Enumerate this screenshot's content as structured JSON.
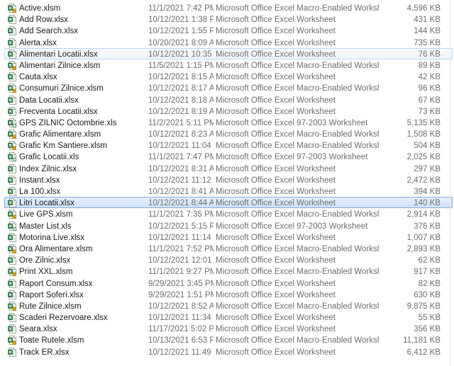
{
  "files": [
    {
      "name": "Active.xlsm",
      "date": "11/1/2021 7:42 PM",
      "type": "Microsoft Office Excel Macro-Enabled Worksheet",
      "size": "4,596 KB",
      "icon": "excel-macro-file-icon"
    },
    {
      "name": "Add Row.xlsx",
      "date": "10/12/2021 1:38 PM",
      "type": "Microsoft Office Excel Worksheet",
      "size": "431 KB",
      "icon": "excel-file-icon"
    },
    {
      "name": "Add Search.xlsx",
      "date": "10/12/2021 1:55 PM",
      "type": "Microsoft Office Excel Worksheet",
      "size": "144 KB",
      "icon": "excel-file-icon"
    },
    {
      "name": "Alerta.xlsx",
      "date": "10/20/2021 8:09 AM",
      "type": "Microsoft Office Excel Worksheet",
      "size": "735 KB",
      "icon": "excel-file-icon"
    },
    {
      "name": "Alimentari Locatii.xlsx",
      "date": "10/12/2021 10:35 ...",
      "type": "Microsoft Office Excel Worksheet",
      "size": "76 KB",
      "icon": "excel-file-icon",
      "state": "hover"
    },
    {
      "name": "Alimentari Zilnice.xlsm",
      "date": "11/5/2021 1:15 PM",
      "type": "Microsoft Office Excel Macro-Enabled Worksheet",
      "size": "89 KB",
      "icon": "excel-macro-file-icon"
    },
    {
      "name": "Cauta.xlsx",
      "date": "10/12/2021 8:15 AM",
      "type": "Microsoft Office Excel Worksheet",
      "size": "42 KB",
      "icon": "excel-file-icon"
    },
    {
      "name": "Consumuri Zilnice.xlsm",
      "date": "10/12/2021 8:17 AM",
      "type": "Microsoft Office Excel Macro-Enabled Worksheet",
      "size": "96 KB",
      "icon": "excel-macro-file-icon"
    },
    {
      "name": "Data Locatii.xlsx",
      "date": "10/12/2021 8:18 AM",
      "type": "Microsoft Office Excel Worksheet",
      "size": "67 KB",
      "icon": "excel-file-icon"
    },
    {
      "name": "Frecventa Locatii.xlsx",
      "date": "10/12/2021 8:19 AM",
      "type": "Microsoft Office Excel Worksheet",
      "size": "73 KB",
      "icon": "excel-file-icon"
    },
    {
      "name": "GPS ZILNIC Octombrie.xls",
      "date": "11/2/2021 5:11 PM",
      "type": "Microsoft Office Excel 97-2003 Worksheet",
      "size": "5,135 KB",
      "icon": "excel-97-file-icon"
    },
    {
      "name": "Grafic Alimentare.xlsm",
      "date": "10/12/2021 8:23 AM",
      "type": "Microsoft Office Excel Macro-Enabled Worksheet",
      "size": "1,508 KB",
      "icon": "excel-macro-file-icon"
    },
    {
      "name": "Grafic Km Santiere.xlsm",
      "date": "10/12/2021 11:04 ...",
      "type": "Microsoft Office Excel Macro-Enabled Worksheet",
      "size": "504 KB",
      "icon": "excel-macro-file-icon"
    },
    {
      "name": "Grafic Locatii.xls",
      "date": "11/1/2021 7:47 PM",
      "type": "Microsoft Office Excel 97-2003 Worksheet",
      "size": "2,025 KB",
      "icon": "excel-97-file-icon"
    },
    {
      "name": "Index Zilnic.xlsx",
      "date": "10/12/2021 8:31 AM",
      "type": "Microsoft Office Excel Worksheet",
      "size": "297 KB",
      "icon": "excel-file-icon"
    },
    {
      "name": "Instant.xlsx",
      "date": "10/12/2021 11:12 ...",
      "type": "Microsoft Office Excel Worksheet",
      "size": "2,472 KB",
      "icon": "excel-file-icon"
    },
    {
      "name": "La 100.xlsx",
      "date": "10/12/2021 8:41 AM",
      "type": "Microsoft Office Excel Worksheet",
      "size": "394 KB",
      "icon": "excel-file-icon"
    },
    {
      "name": "Litri Locatii.xlsx",
      "date": "10/12/2021 8:44 AM",
      "type": "Microsoft Office Excel Worksheet",
      "size": "140 KB",
      "icon": "excel-file-icon",
      "state": "selected"
    },
    {
      "name": "Live GPS.xlsm",
      "date": "11/1/2021 7:35 PM",
      "type": "Microsoft Office Excel Macro-Enabled Worksheet",
      "size": "2,914 KB",
      "icon": "excel-macro-file-icon"
    },
    {
      "name": "Master List.xls",
      "date": "10/12/2021 5:15 PM",
      "type": "Microsoft Office Excel 97-2003 Worksheet",
      "size": "376 KB",
      "icon": "excel-97-file-icon"
    },
    {
      "name": "Motorina Live.xlsx",
      "date": "10/12/2021 11:14 ...",
      "type": "Microsoft Office Excel Worksheet",
      "size": "1,007 KB",
      "icon": "excel-file-icon"
    },
    {
      "name": "Ora Alimentare.xlsm",
      "date": "11/1/2021 7:52 PM",
      "type": "Microsoft Office Excel Macro-Enabled Worksheet",
      "size": "2,893 KB",
      "icon": "excel-macro-file-icon"
    },
    {
      "name": "Ore Zilnic.xlsx",
      "date": "10/12/2021 12:01 ...",
      "type": "Microsoft Office Excel Worksheet",
      "size": "62 KB",
      "icon": "excel-file-icon"
    },
    {
      "name": "Print XXL.xlsm",
      "date": "11/1/2021 9:27 PM",
      "type": "Microsoft Office Excel Macro-Enabled Worksheet",
      "size": "917 KB",
      "icon": "excel-macro-file-icon"
    },
    {
      "name": "Raport Consum.xlsx",
      "date": "9/29/2021 3:45 PM",
      "type": "Microsoft Office Excel Worksheet",
      "size": "82 KB",
      "icon": "excel-file-icon"
    },
    {
      "name": "Raport Soferi.xlsx",
      "date": "9/29/2021 1:51 PM",
      "type": "Microsoft Office Excel Worksheet",
      "size": "630 KB",
      "icon": "excel-file-icon"
    },
    {
      "name": "Rute Zilnice.xlsm",
      "date": "10/12/2021 8:52 AM",
      "type": "Microsoft Office Excel Macro-Enabled Worksheet",
      "size": "9,875 KB",
      "icon": "excel-macro-file-icon"
    },
    {
      "name": "Scaderi Rezervoare.xlsx",
      "date": "10/12/2021 11:34 ...",
      "type": "Microsoft Office Excel Worksheet",
      "size": "55 KB",
      "icon": "excel-file-icon"
    },
    {
      "name": "Seara.xlsx",
      "date": "11/17/2021 5:02 PM",
      "type": "Microsoft Office Excel Worksheet",
      "size": "356 KB",
      "icon": "excel-file-icon"
    },
    {
      "name": "Toate Rutele.xlsm",
      "date": "10/13/2021 6:53 PM",
      "type": "Microsoft Office Excel Macro-Enabled Worksheet",
      "size": "11,181 KB",
      "icon": "excel-macro-file-icon"
    },
    {
      "name": "Track ER.xlsx",
      "date": "10/12/2021 11:49 ...",
      "type": "Microsoft Office Excel Worksheet",
      "size": "6,412 KB",
      "icon": "excel-file-icon"
    }
  ],
  "colors": {
    "excel_green": "#1e7a3c",
    "macro_accent": "#d9a400",
    "hover_border": "#b8d6fb",
    "selected_border": "#84acdd"
  }
}
